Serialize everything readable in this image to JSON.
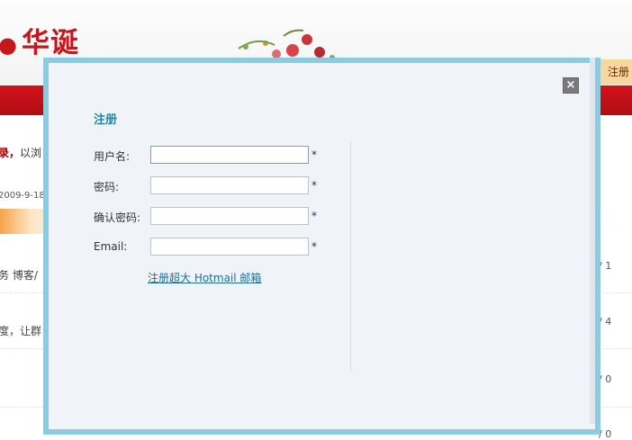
{
  "background": {
    "logo_text": "华诞",
    "top_register": "注册",
    "login_fragment_bold": "录，",
    "login_fragment_rest": "以浏",
    "date_fragment": "2009-9-18)",
    "posts_fragment": "务  博客/",
    "group_fragment": "度，让群",
    "counts": [
      "/ 1",
      "/ 4",
      "/ 0",
      "/ 0"
    ]
  },
  "dialog": {
    "title": "注册",
    "close_label": "×",
    "fields": [
      {
        "label": "用户名:",
        "value": "",
        "required": "*"
      },
      {
        "label": "密码:",
        "value": "",
        "required": "*"
      },
      {
        "label": "确认密码:",
        "value": "",
        "required": "*"
      },
      {
        "label": "Email:",
        "value": "",
        "required": "*"
      }
    ],
    "hotmail_link": "注册超大 Hotmail 邮箱"
  },
  "colors": {
    "brand_red": "#c8161d",
    "dialog_border": "#8ccbe0",
    "title_blue": "#1b88a8"
  }
}
